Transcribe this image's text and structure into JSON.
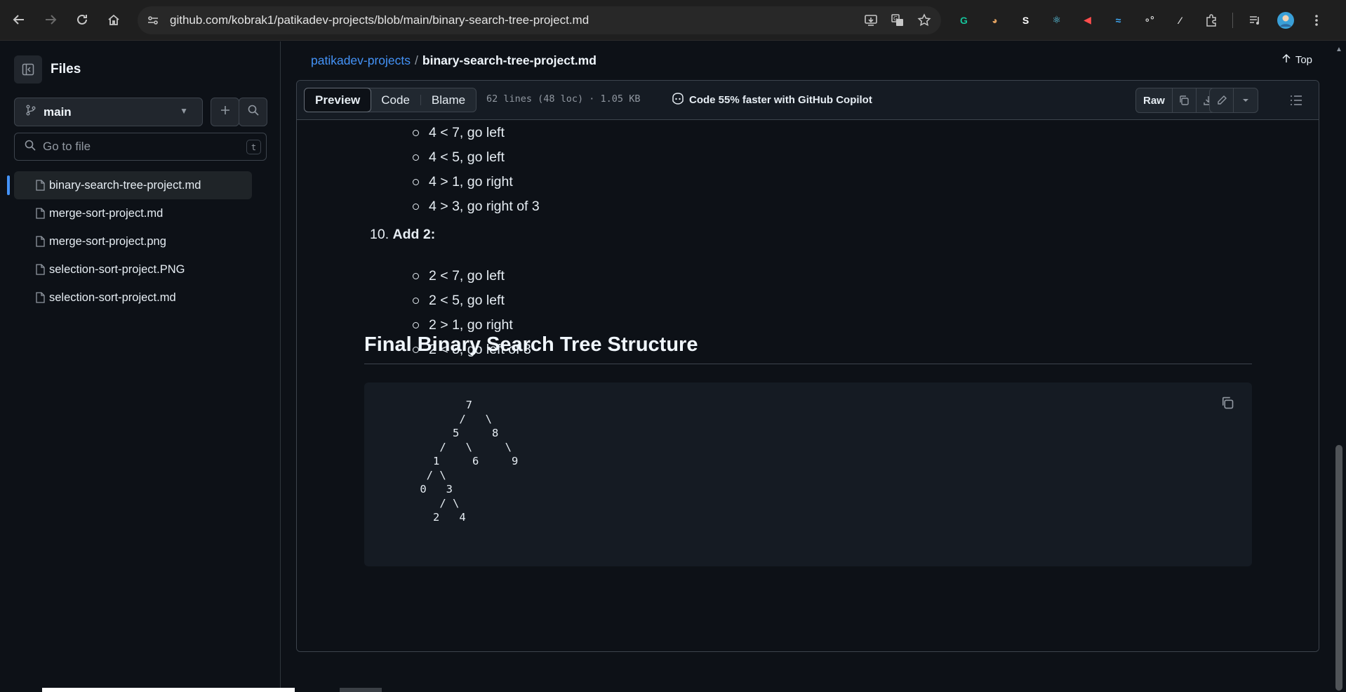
{
  "browser": {
    "url": "github.com/kobrak1/patikadev-projects/blob/main/binary-search-tree-project.md",
    "extensions": [
      {
        "name": "grammarly-icon",
        "glyph": "G",
        "color": "#15c39a"
      },
      {
        "name": "reader-icon",
        "glyph": "◕",
        "color": "#e0a060"
      },
      {
        "name": "s-ext-icon",
        "glyph": "S",
        "color": "#ffffff"
      },
      {
        "name": "react-devtools-icon",
        "glyph": "⚛",
        "color": "#61dafb"
      },
      {
        "name": "speaker-ext-icon",
        "glyph": "◀",
        "color": "#ff4d4d"
      },
      {
        "name": "wave-ext-icon",
        "glyph": "≈",
        "color": "#3fa9f5"
      },
      {
        "name": "dots-ext-icon",
        "glyph": "∘°",
        "color": "#dddddd"
      },
      {
        "name": "eyedropper-ext-icon",
        "glyph": "⁄",
        "color": "#dddddd"
      }
    ]
  },
  "sidebar": {
    "title": "Files",
    "branch": "main",
    "search_placeholder": "Go to file",
    "search_shortcut": "t",
    "files": [
      {
        "label": "binary-search-tree-project.md",
        "active": true
      },
      {
        "label": "merge-sort-project.md",
        "active": false
      },
      {
        "label": "merge-sort-project.png",
        "active": false
      },
      {
        "label": "selection-sort-project.PNG",
        "active": false
      },
      {
        "label": "selection-sort-project.md",
        "active": false
      }
    ]
  },
  "breadcrumb": {
    "repo": "patikadev-projects",
    "separator": "/",
    "file": "binary-search-tree-project.md",
    "top_label": "Top"
  },
  "file_header": {
    "tabs": [
      "Preview",
      "Code",
      "Blame"
    ],
    "active_tab": "Preview",
    "meta": "62 lines (48 loc) · 1.05 KB",
    "copilot": "Code 55% faster with GitHub Copilot",
    "raw_label": "Raw"
  },
  "content": {
    "list_a": [
      "4 < 7, go left",
      "4 < 5, go left",
      "4 > 1, go right",
      "4 > 3, go right of 3"
    ],
    "ol_number": "10.",
    "ol_label": "Add 2:",
    "list_b": [
      "2 < 7, go left",
      "2 < 5, go left",
      "2 > 1, go right",
      "2 < 3, go left of 3"
    ],
    "heading": "Final Binary Search Tree Structure",
    "code": "        7\n       /   \\\n      5     8\n    /   \\     \\\n   1     6     9\n  / \\\n 0   3\n    / \\\n   2   4"
  }
}
